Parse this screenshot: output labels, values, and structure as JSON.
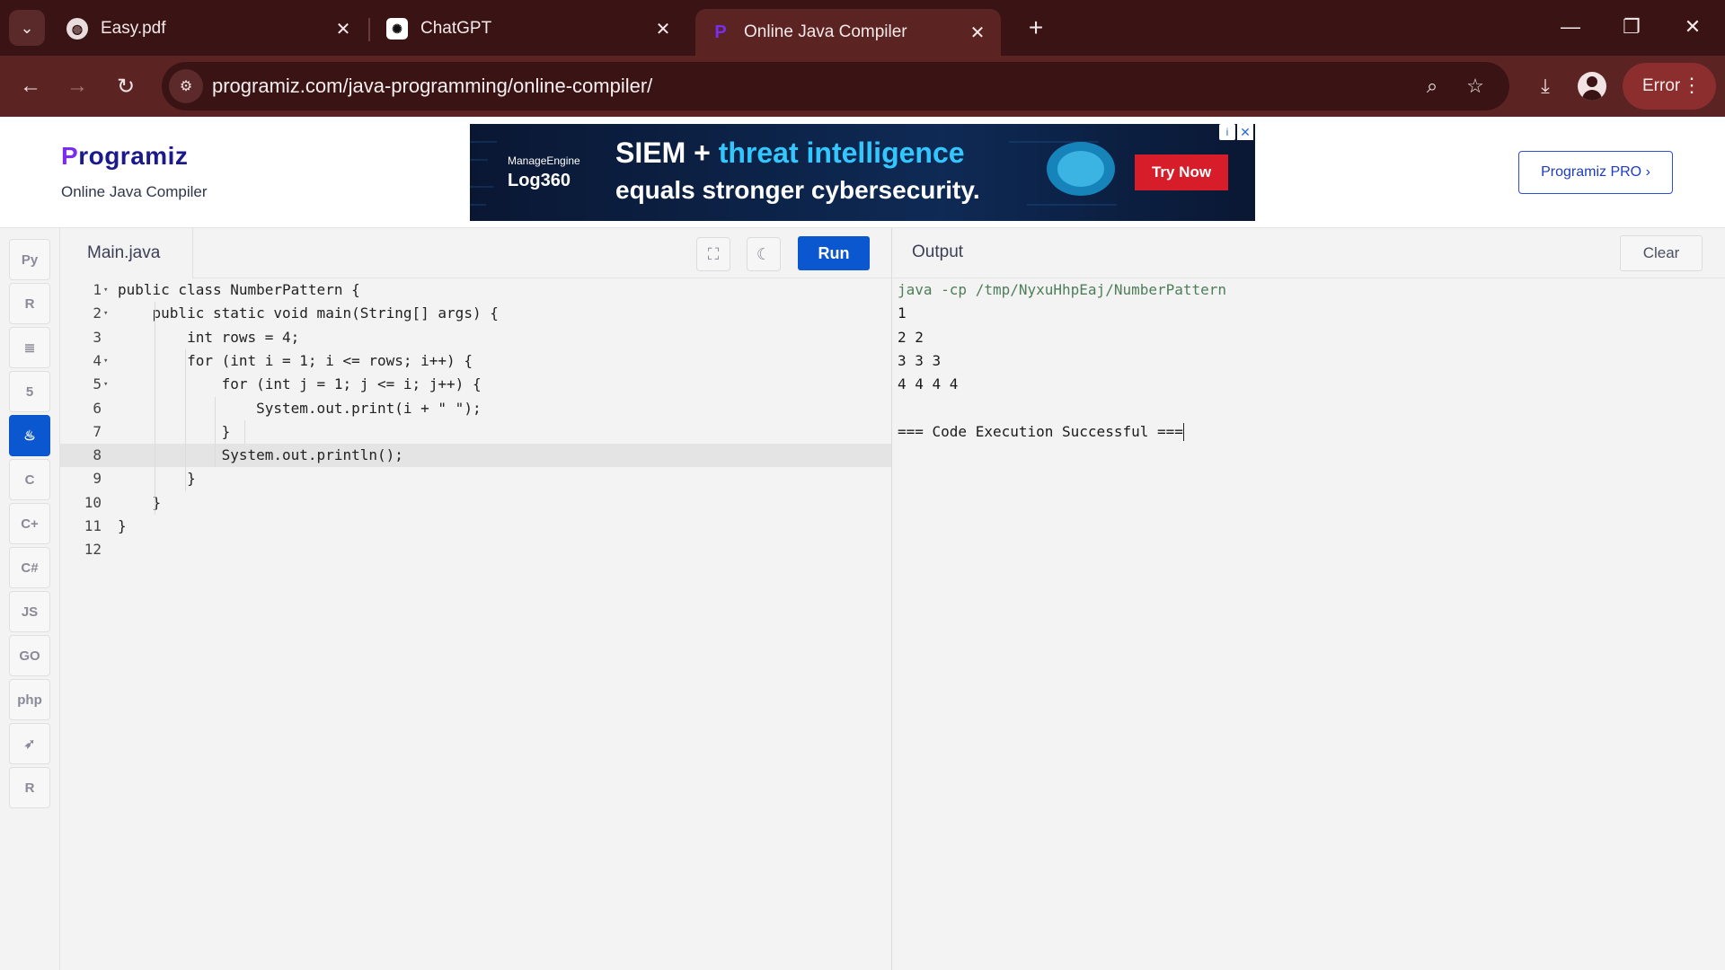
{
  "browser": {
    "tabs": [
      {
        "title": "Easy.pdf",
        "icon": "globe-icon",
        "active": false
      },
      {
        "title": "ChatGPT",
        "icon": "chatgpt-icon",
        "active": false
      },
      {
        "title": "Online Java Compiler",
        "icon": "programiz-icon",
        "active": true
      }
    ],
    "new_tab": "+",
    "url": "programiz.com/java-programming/online-compiler/",
    "profile_button": "Error"
  },
  "site": {
    "logo_initial": "P",
    "logo_rest": "rogramiz",
    "subtitle": "Online Java Compiler",
    "pro_button": "Programiz PRO ›"
  },
  "ad": {
    "brand": "ManageEngine",
    "product": "Log360",
    "line1_a": "SIEM + ",
    "line1_b": "threat intelligence",
    "line2": "equals stronger cybersecurity.",
    "cta": "Try Now"
  },
  "rail": [
    {
      "name": "python",
      "glyph": "Py",
      "active": false
    },
    {
      "name": "r",
      "glyph": "R",
      "active": false
    },
    {
      "name": "sql",
      "glyph": "≣",
      "active": false
    },
    {
      "name": "html",
      "glyph": "5",
      "active": false
    },
    {
      "name": "java",
      "glyph": "♨",
      "active": true
    },
    {
      "name": "c",
      "glyph": "C",
      "active": false
    },
    {
      "name": "cpp",
      "glyph": "C+",
      "active": false
    },
    {
      "name": "csharp",
      "glyph": "C#",
      "active": false
    },
    {
      "name": "javascript",
      "glyph": "JS",
      "active": false
    },
    {
      "name": "go",
      "glyph": "GO",
      "active": false
    },
    {
      "name": "php",
      "glyph": "php",
      "active": false
    },
    {
      "name": "swift",
      "glyph": "➶",
      "active": false
    },
    {
      "name": "rust",
      "glyph": "R",
      "active": false
    }
  ],
  "editor": {
    "file_tab": "Main.java",
    "run_label": "Run",
    "highlighted_line": 8,
    "lines": [
      {
        "n": "1",
        "fold": true,
        "text": "public class NumberPattern {"
      },
      {
        "n": "2",
        "fold": true,
        "text": "    public static void main(String[] args) {"
      },
      {
        "n": "3",
        "fold": false,
        "text": "        int rows = 4;"
      },
      {
        "n": "4",
        "fold": true,
        "text": "        for (int i = 1; i <= rows; i++) {"
      },
      {
        "n": "5",
        "fold": true,
        "text": "            for (int j = 1; j <= i; j++) {"
      },
      {
        "n": "6",
        "fold": false,
        "text": "                System.out.print(i + \" \");"
      },
      {
        "n": "7",
        "fold": false,
        "text": "            }"
      },
      {
        "n": "8",
        "fold": false,
        "text": "            System.out.println();"
      },
      {
        "n": "9",
        "fold": false,
        "text": "        }"
      },
      {
        "n": "10",
        "fold": false,
        "text": "    }"
      },
      {
        "n": "11",
        "fold": false,
        "text": "}"
      },
      {
        "n": "12",
        "fold": false,
        "text": ""
      }
    ]
  },
  "output": {
    "title": "Output",
    "clear_label": "Clear",
    "command": "java -cp /tmp/NyxuHhpEaj/NumberPattern",
    "lines": [
      "1",
      "2 2",
      "3 3 3",
      "4 4 4 4",
      "",
      "=== Code Execution Successful ==="
    ]
  }
}
